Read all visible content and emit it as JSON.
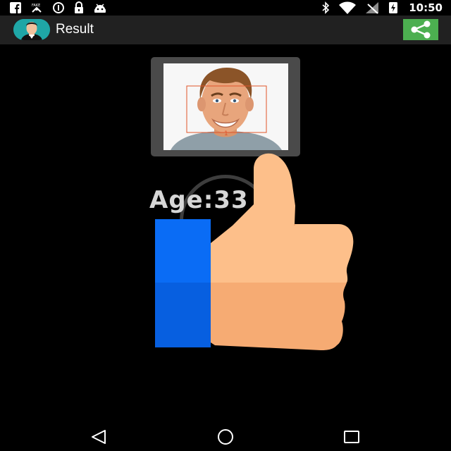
{
  "status_bar": {
    "time": "10:50",
    "left_icons": [
      "facebook-icon",
      "fake-gps-icon",
      "data-saver-icon",
      "lock-icon",
      "android-icon"
    ],
    "right_icons": [
      "bluetooth-icon",
      "wifi-icon",
      "signal-icon",
      "battery-charging-icon"
    ]
  },
  "app_bar": {
    "title": "Result",
    "share_icon": "share-icon",
    "accent_color": "#4caf50",
    "avatar_color": "#1fa6a6"
  },
  "result": {
    "age_text": "Age:33"
  },
  "overlay": {
    "icon": "thumbs-up-icon",
    "cuff_color": "#0a6cf5",
    "hand_color": "#fdbf8a"
  },
  "nav_bar": {
    "icons": [
      "back-icon",
      "home-icon",
      "recents-icon"
    ]
  }
}
